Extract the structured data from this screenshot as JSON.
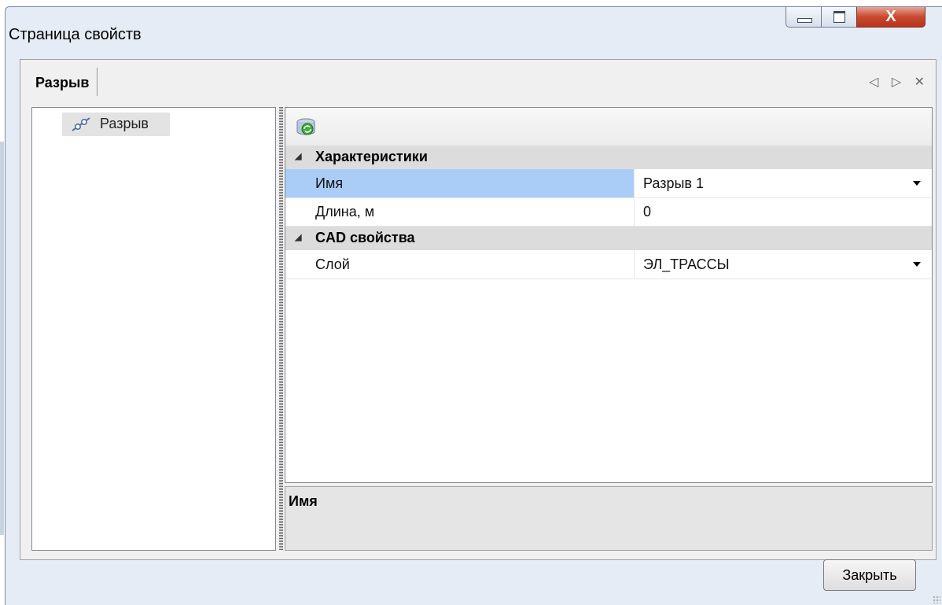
{
  "window": {
    "title": "Страница свойств",
    "close_glyph": "X"
  },
  "tab": {
    "label": "Разрыв",
    "tools": "◁ ▷ ✕"
  },
  "tree": {
    "items": [
      {
        "label": "Разрыв",
        "icon": "break-line-icon"
      }
    ]
  },
  "toolbar": {
    "refresh_icon": "refresh-icon"
  },
  "properties": {
    "categories": [
      {
        "label": "Характеристики",
        "rows": [
          {
            "name": "Имя",
            "value": "Разрыв 1",
            "dropdown": true,
            "selected": true
          },
          {
            "name": "Длина, м",
            "value": "0",
            "dropdown": false,
            "selected": false
          }
        ]
      },
      {
        "label": "CAD свойства",
        "rows": [
          {
            "name": "Слой",
            "value": "ЭЛ_ТРАССЫ",
            "dropdown": true,
            "selected": false
          }
        ]
      }
    ]
  },
  "description": {
    "title": "Имя"
  },
  "buttons": {
    "close": "Закрыть"
  },
  "colors": {
    "selection": "#a9cdf7",
    "category_bg": "#dcdcdc",
    "window_frame": "#e5ecf5",
    "close_button_red": "#c8492e"
  }
}
